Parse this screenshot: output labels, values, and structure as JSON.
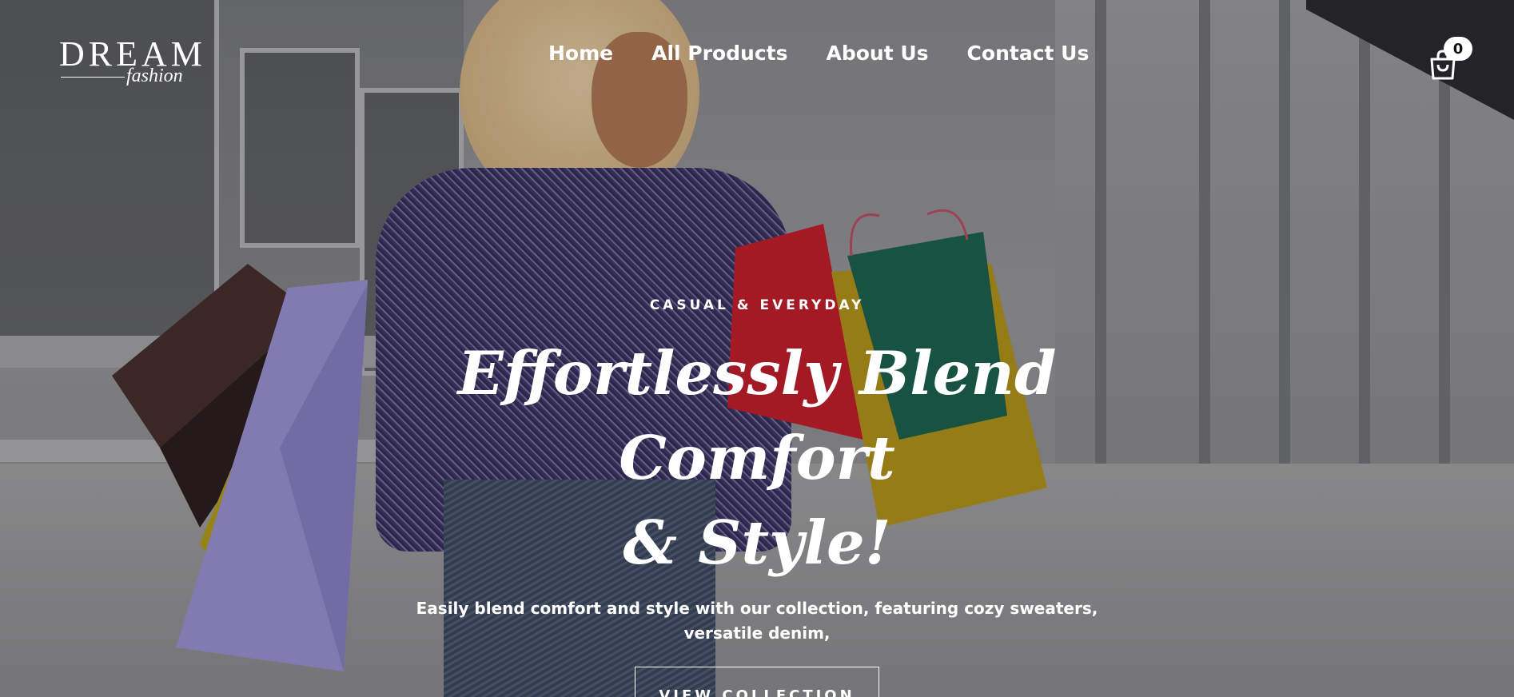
{
  "brand": {
    "name": "DREAM",
    "tagline": "fashion"
  },
  "nav": {
    "items": [
      {
        "label": "Home"
      },
      {
        "label": "All Products"
      },
      {
        "label": "About Us"
      },
      {
        "label": "Contact Us"
      }
    ]
  },
  "cart": {
    "count": "0",
    "icon": "shopping-bag-icon"
  },
  "hero": {
    "eyebrow": "CASUAL & EVERYDAY",
    "title_line1": "Effortlessly Blend Comfort",
    "title_line2": "& Style!",
    "subtitle": "Easily blend comfort and style with our collection, featuring cozy sweaters, versatile denim,",
    "cta_label": "VIEW COLLECTION"
  },
  "colors": {
    "text": "#ffffff",
    "badge_bg": "#ffffff",
    "badge_text": "#111111"
  }
}
